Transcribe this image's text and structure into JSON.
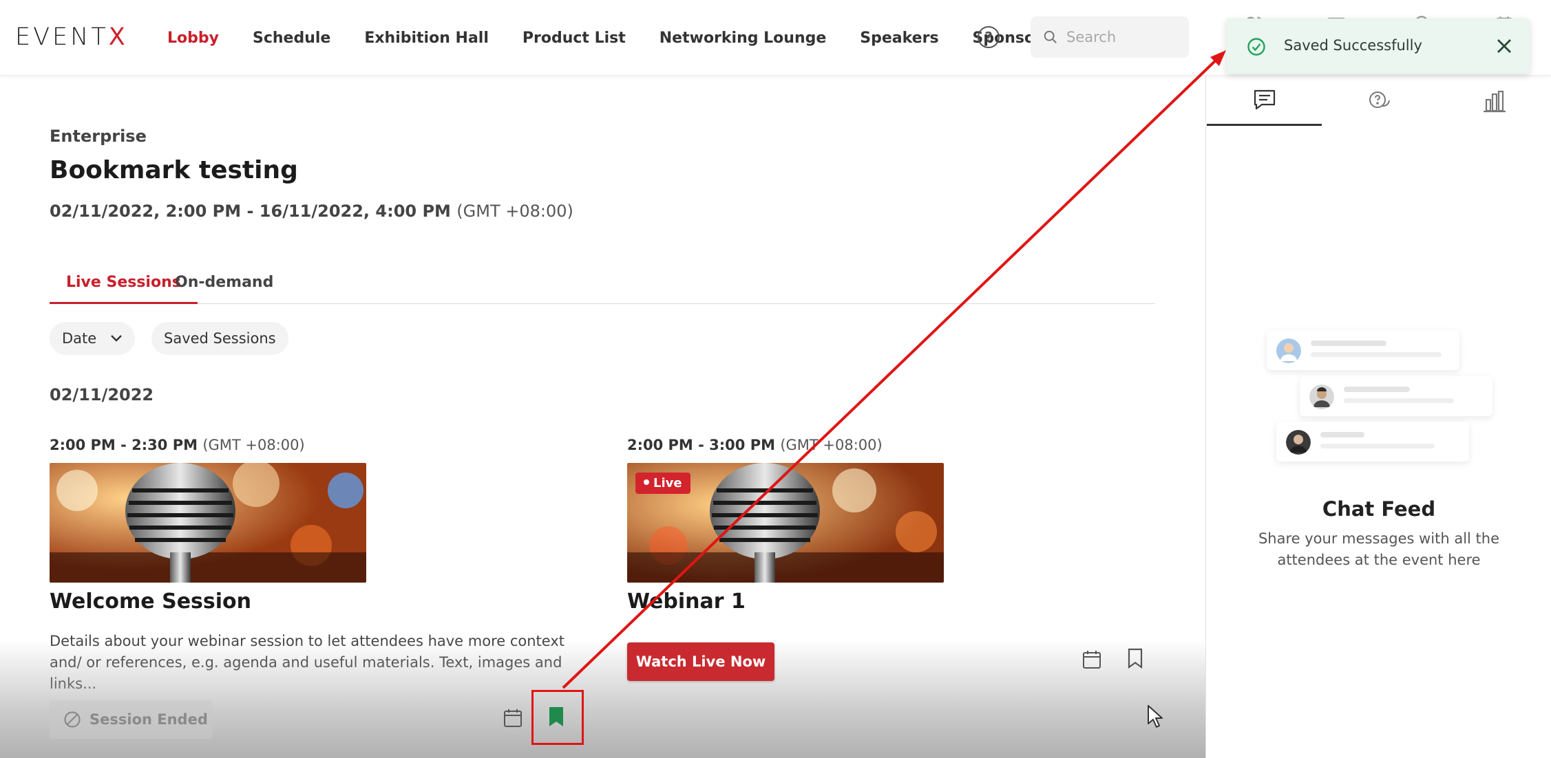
{
  "header": {
    "logo_main": "EVENT",
    "logo_accent": "X",
    "nav": [
      "Lobby",
      "Schedule",
      "Exhibition Hall",
      "Product List",
      "Networking Lounge",
      "Speakers",
      "Sponsors"
    ],
    "help_label": "?",
    "search_placeholder": "Search"
  },
  "toast": {
    "message": "Saved Successfully"
  },
  "event": {
    "category": "Enterprise",
    "title": "Bookmark testing",
    "dates": "02/11/2022, 2:00 PM - 16/11/2022, 4:00 PM",
    "timezone": "(GMT +08:00)"
  },
  "tabs": [
    "Live Sessions",
    "On-demand"
  ],
  "filters": {
    "date_label": "Date",
    "saved_label": "Saved Sessions"
  },
  "date_heading": "02/11/2022",
  "sessions": [
    {
      "time": "2:00 PM - 2:30 PM",
      "timezone": "(GMT +08:00)",
      "name": "Welcome Session",
      "description": "Details about your webinar session to let attendees have more context and/ or references, e.g. agenda and useful materials. Text, images and links...",
      "status_label": "Session Ended",
      "bookmarked": true
    },
    {
      "time": "2:00 PM - 3:00 PM",
      "timezone": "(GMT +08:00)",
      "name": "Webinar 1",
      "live_label": "Live",
      "action_label": "Watch Live Now",
      "bookmarked": false
    }
  ],
  "right_panel": {
    "feed_title": "Chat Feed",
    "feed_subtitle": "Share your messages with all the attendees at the event here"
  },
  "colors": {
    "brand": "#c8202b",
    "bookmark_saved": "#1e8a4c",
    "toast_bg": "#eaf6ef",
    "annotation": "#e01515"
  }
}
